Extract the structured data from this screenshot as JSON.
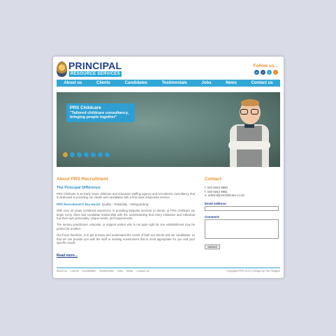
{
  "logo": {
    "title": "PRINCIPAL",
    "subtitle": "RESOURCE SERVICES"
  },
  "follow": {
    "label": "Follow us...",
    "icons": [
      "linkedin-icon",
      "facebook-icon",
      "twitter-icon",
      "rss-icon"
    ],
    "colors": [
      "#1f6fb2",
      "#3b5998",
      "#2aa7d8",
      "#f08a24"
    ]
  },
  "nav": [
    "About us",
    "Clients",
    "Candidates",
    "Testimonials",
    "Jobs",
    "News",
    "Contact us"
  ],
  "banner": {
    "title": "PRS Childcare",
    "tagline": "\"Tailored childcare consultancy, bringing people together\"",
    "slide_count": 7,
    "active_slide": 1
  },
  "about": {
    "heading": "About PRS Recruitment",
    "subheading": "The Principal Difference",
    "p1": "PRS Childcare is an Early Years childcare and education staffing agency and recruitment consultancy that is dedicated to providing our clients and candidates with a first class responsive service.",
    "kw_label": "PRS Recruitment's key words:",
    "kw_values": "Quality - Reliability - Safeguarding.",
    "p2": "With over 20 years combined experience in providing bespoke services to clients, at PRS Childcare we begin every client and candidate relationship with the understanding that every institution and individual has their own personality, unique needs, and requirements.",
    "p3": "The nursery practitioner, educator, or support worker who is not quite right for one establishment may be perfect for another.",
    "p4": "Our focus therefore, is to get to know and understand the needs of both our clients and our candidates, so that we can provide you with the staff or working environment that is most appropriate for you and your specific needs.",
    "read_more": "Read more..."
  },
  "contact": {
    "heading": "Contact",
    "tel": "t: 020 8343 9980",
    "fax": "f: 020 8343 9981",
    "email": "e: admin@prschildcare.co.uk",
    "email_label": "Email Address:",
    "comment_label": "Comment:",
    "submit": "Submit"
  },
  "footer": {
    "links": [
      "About us",
      "Clients",
      "Candidates",
      "Testimonials",
      "Jobs",
      "News",
      "Contact us"
    ],
    "copyright": "Copyright PRS 2013  |  Design by Tim Hodgkin"
  }
}
